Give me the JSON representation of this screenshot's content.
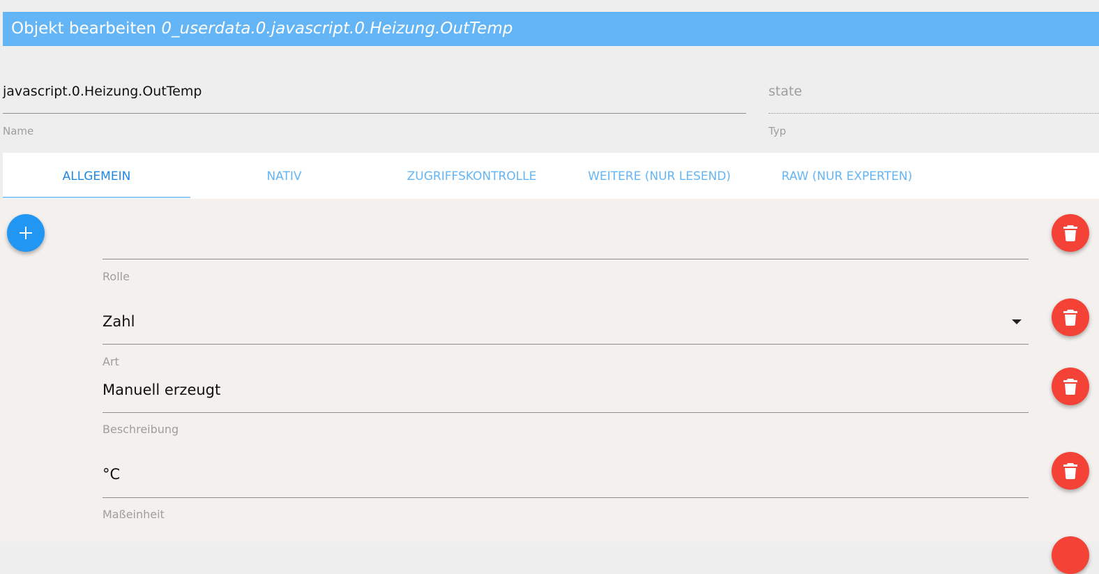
{
  "dialog": {
    "title_prefix": "Objekt bearbeiten",
    "object_id": "0_userdata.0.javascript.0.Heizung.OutTemp"
  },
  "header_fields": {
    "name": {
      "value": "javascript.0.Heizung.OutTemp",
      "label": "Name"
    },
    "type": {
      "value": "state",
      "label": "Typ"
    }
  },
  "tabs": [
    {
      "label": "ALLGEMEIN",
      "active": true
    },
    {
      "label": "NATIV",
      "active": false
    },
    {
      "label": "ZUGRIFFSKONTROLLE",
      "active": false
    },
    {
      "label": "WEITERE (NUR LESEND)",
      "active": false
    },
    {
      "label": "RAW (NUR EXPERTEN)",
      "active": false
    }
  ],
  "properties": {
    "role": {
      "value": "",
      "label": "Rolle"
    },
    "art": {
      "value": "Zahl",
      "label": "Art"
    },
    "description": {
      "value": "Manuell erzeugt",
      "label": "Beschreibung"
    },
    "unit": {
      "value": "°C",
      "label": "Maßeinheit"
    }
  },
  "icons": {
    "add": "plus-icon",
    "delete": "trash-icon",
    "dropdown": "caret-down-icon"
  },
  "colors": {
    "title_bar": "#64b5f6",
    "tab_text": "#64b5f6",
    "tab_active": "#1e88e5",
    "add_button": "#2196f3",
    "delete_button": "#f44336",
    "content_bg": "#f3f0ee"
  }
}
